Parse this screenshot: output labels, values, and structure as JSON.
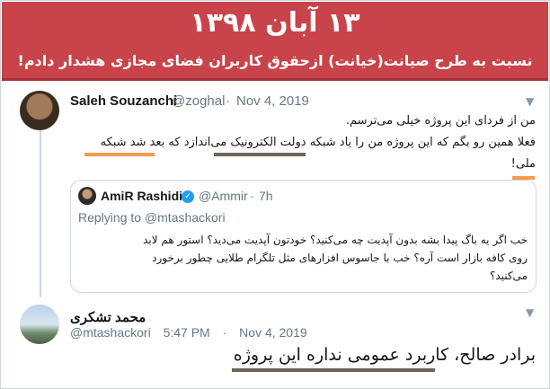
{
  "banner": {
    "date": "۱۳ آبان ۱۳۹۸",
    "subtitle": "نسبت به طرح صیانت(خیانت) ازحقوق کاربران فضای مجازی هشدار دادم!",
    "bg_color": "#c8444a"
  },
  "tweet1": {
    "name": "Saleh Souzanchi",
    "handle": "@zoghal",
    "separator": "·",
    "date": "Nov 4, 2019",
    "menu_icon": "chevron-down-icon",
    "lines": [
      "من از فردای این پروژه خیلی می‌ترسم.",
      "فعلا همین رو بگم که این پروژه من را یاد شبکه دولت الکترونیک می‌اندازد که بعد شد شبکه",
      "ملی!"
    ]
  },
  "quote": {
    "name": "AmiR Rashidi",
    "handle": "@Ammir",
    "separator": "·",
    "time": "7h",
    "verified_icon": "verified-badge-icon",
    "replying_prefix": "Replying to",
    "replying_to": "@mtashackori",
    "lines": [
      "خب اگر یه باگ پیدا بشه بدون آپدیت چه می‌کنید؟ خودتون آپدیت می‌دید؟ استور هم لابد",
      "روی کافه بازار است آره؟ خب با جاسوس افزارهای مثل تلگرام طلایی چطور برخورد",
      "می‌کنید؟"
    ]
  },
  "tweet3": {
    "name": "محمد تشکری",
    "handle": "@mtashackori",
    "time": "5:47 PM",
    "separator": "·",
    "date": "Nov 4, 2019",
    "menu_icon": "chevron-down-icon",
    "text": "برادر صالح، کاربرد عمومی نداره این پروژه"
  },
  "highlight_colors": {
    "orange": "#f59a4c",
    "gray": "#6e6658"
  }
}
